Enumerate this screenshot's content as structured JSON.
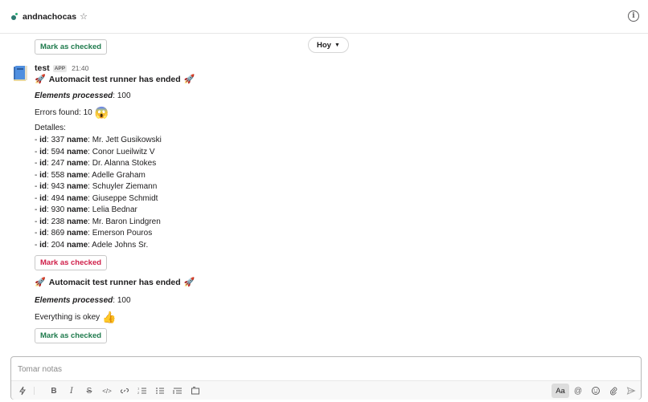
{
  "header": {
    "channel_name": "andnachocas",
    "star_icon": "star-icon",
    "info_icon": "info-icon",
    "info_glyph": "i"
  },
  "date_divider": {
    "label": "Hoy"
  },
  "messages": {
    "top_check_label": "Mark as checked",
    "sender": "test",
    "app_badge": "APP",
    "time": "21:40",
    "msg1": {
      "title": "Automacit test runner has ended",
      "elements_label": "Elements processed",
      "elements_value": ": 100",
      "errors_text": "Errors found: 10",
      "errors_emoji": "😱",
      "details_label": "Detalles:",
      "items": [
        {
          "id": "337",
          "name": "Mr. Jett Gusikowski"
        },
        {
          "id": "594",
          "name": "Conor Lueilwitz V"
        },
        {
          "id": "247",
          "name": "Dr. Alanna Stokes"
        },
        {
          "id": "558",
          "name": "Adelle Graham"
        },
        {
          "id": "943",
          "name": "Schuyler Ziemann"
        },
        {
          "id": "494",
          "name": "Giuseppe Schmidt"
        },
        {
          "id": "930",
          "name": "Lelia Bednar"
        },
        {
          "id": "238",
          "name": "Mr. Baron Lindgren"
        },
        {
          "id": "869",
          "name": "Emerson Pouros"
        },
        {
          "id": "204",
          "name": "Adele Johns Sr."
        }
      ],
      "check_label": "Mark as checked"
    },
    "msg2": {
      "title": "Automacit test runner has ended",
      "elements_label": "Elements processed",
      "elements_value": ": 100",
      "status_text": "Everything is okey",
      "status_emoji": "👍",
      "check_label": "Mark as checked"
    },
    "rocket_emoji": "🚀",
    "item_prefix": "- ",
    "item_id_label": "id",
    "item_name_label": "name",
    "colors": {
      "check_green": "#1e7a4c",
      "check_red": "#d0204a"
    }
  },
  "composer": {
    "placeholder": "Tomar notas",
    "aa_label": "Aa",
    "toolbar_icons": [
      "lightning-icon",
      "bold-icon",
      "italic-icon",
      "strikethrough-icon",
      "code-icon",
      "link-icon",
      "ordered-list-icon",
      "bulleted-list-icon",
      "indent-list-icon",
      "code-block-icon",
      "mention-icon",
      "emoji-icon",
      "attachment-icon",
      "send-icon"
    ]
  }
}
